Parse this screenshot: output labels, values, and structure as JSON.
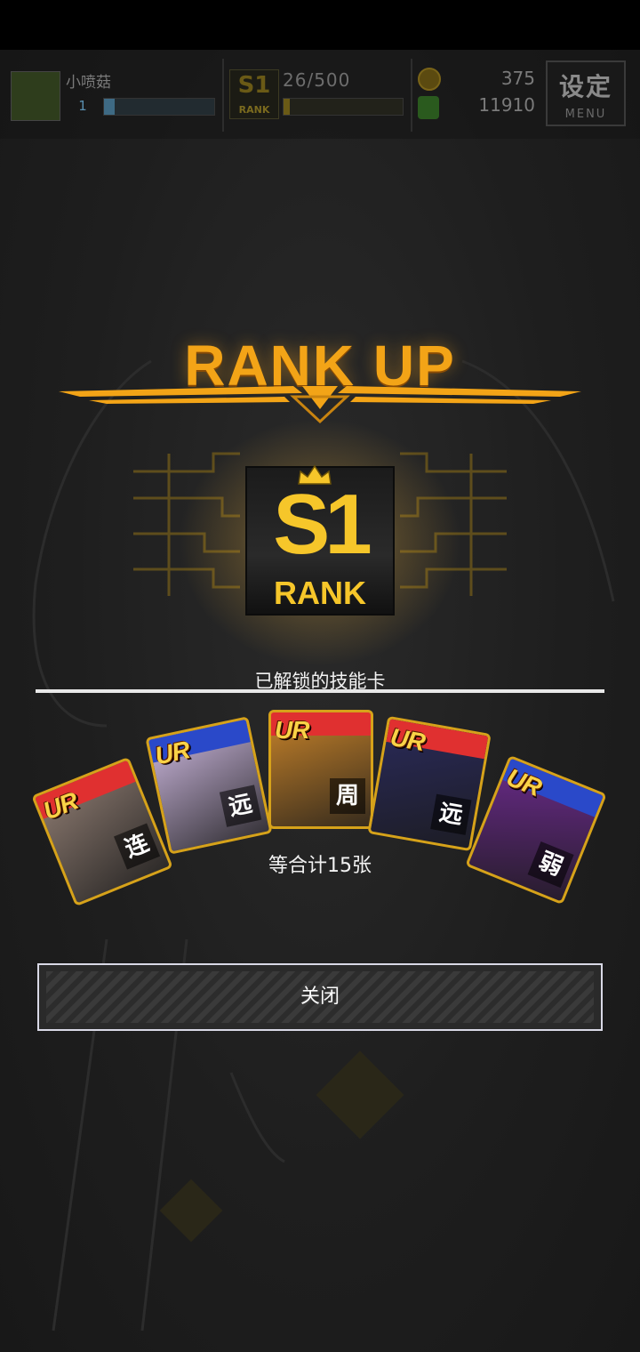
{
  "hud": {
    "player_name": "小喷菇",
    "player_level": "1",
    "exp_fraction": 0.1,
    "rank_badge": "S1",
    "rank_badge_label": "RANK",
    "rank_progress": "26/500",
    "rank_fraction": 0.052,
    "coins": "375",
    "gems": "11910",
    "menu_title": "设定",
    "menu_label": "MENU"
  },
  "rankup": {
    "title": "RANK UP",
    "badge_number": "S1",
    "badge_label": "RANK"
  },
  "unlock": {
    "label": "已解锁的技能卡",
    "total": "等合计15张"
  },
  "cards": [
    {
      "rarity": "UR",
      "tag": "连",
      "stripe_color": "#e03030",
      "art_color": "#8c7a70"
    },
    {
      "rarity": "UR",
      "tag": "远",
      "stripe_color": "#2a49c9",
      "art_color": "#c7b3d8"
    },
    {
      "rarity": "UR",
      "tag": "周",
      "stripe_color": "#e03030",
      "art_color": "#c7832a"
    },
    {
      "rarity": "UR",
      "tag": "远",
      "stripe_color": "#e03030",
      "art_color": "#2a2a5a"
    },
    {
      "rarity": "UR",
      "tag": "弱",
      "stripe_color": "#2a49c9",
      "art_color": "#6a2a8a"
    }
  ],
  "close_button": {
    "label": "关闭"
  },
  "colors": {
    "accent_gold": "#f3a417",
    "rank_gold": "#f6c62a"
  }
}
